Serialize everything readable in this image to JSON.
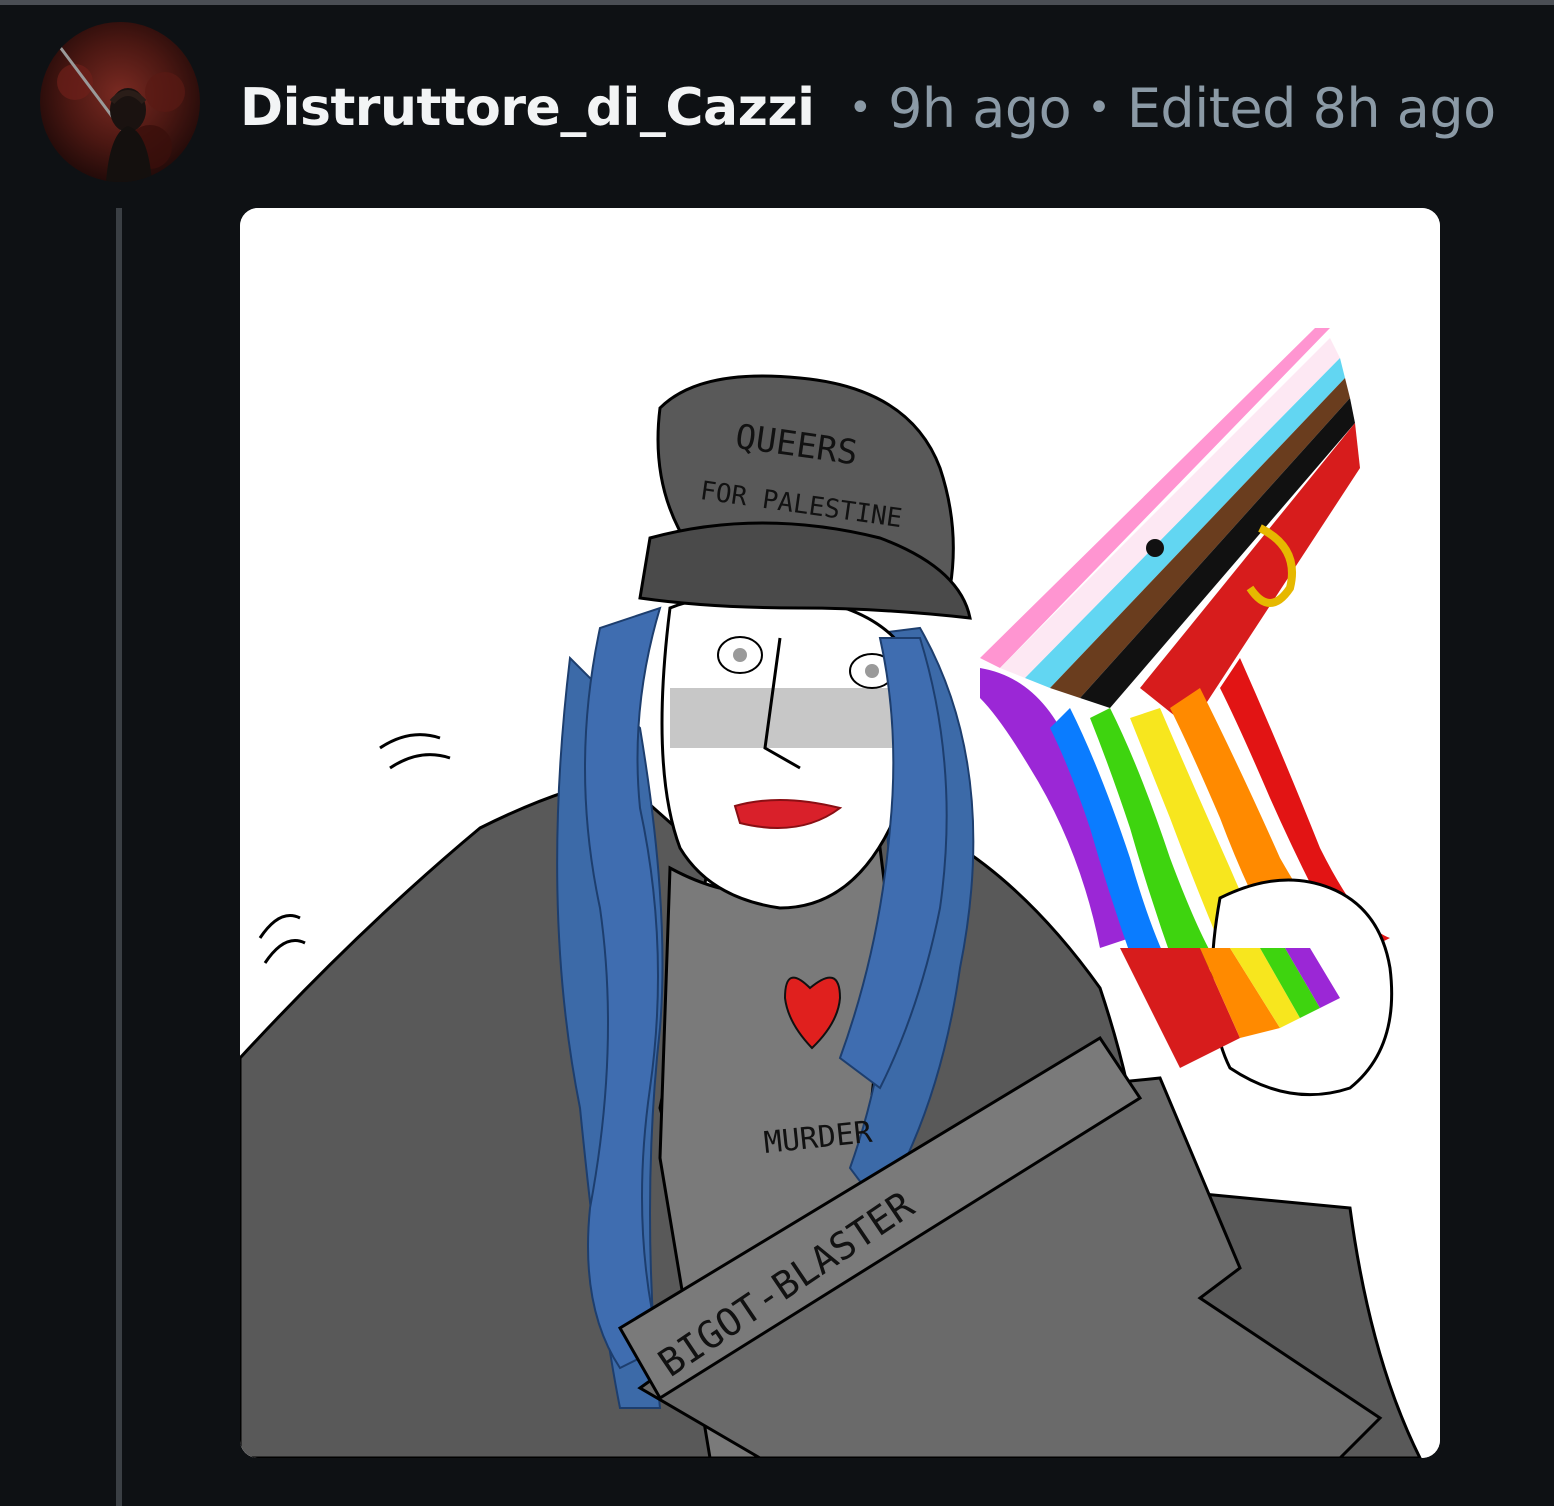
{
  "comment": {
    "author": {
      "username": "Distruttore_di_Cazzi",
      "avatar_icon": "user-avatar"
    },
    "separator": "•",
    "posted_time": "9h ago",
    "edited_time": "Edited 8h ago",
    "image": {
      "texts": {
        "hat_line1": "QUEERS",
        "hat_line2": "FOR PALESTINE",
        "shirt": "MURDER",
        "gun": "BIGOT-BLASTER"
      }
    }
  },
  "colors": {
    "background": "#0e1114",
    "username": "#f2f4f5",
    "meta": "#8b9aa6",
    "thread_line": "#3a3f44"
  }
}
